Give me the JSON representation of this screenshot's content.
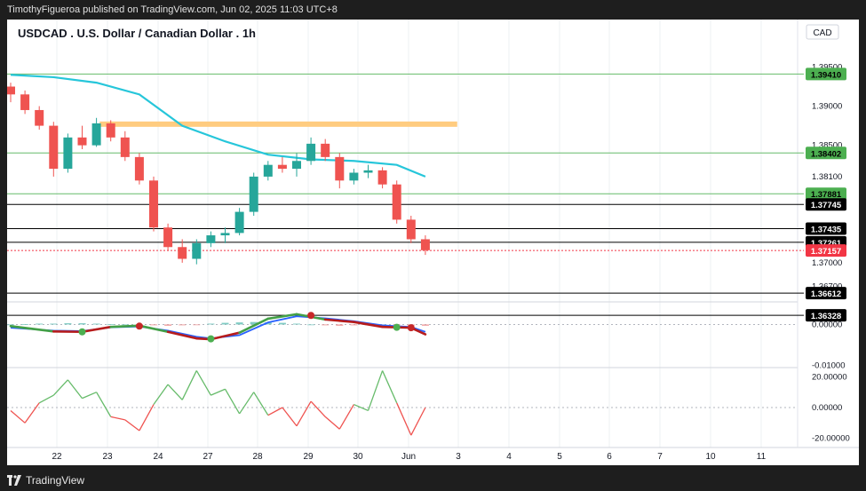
{
  "publish_line": "TimothyFigueroa published on TradingView.com, Jun 02, 2025 11:03 UTC+8",
  "brand": "TradingView",
  "chart_data": {
    "type": "candlestick",
    "title": "USDCAD . U.S. Dollar / Canadian Dollar . 1h",
    "currency": "CAD",
    "x_tick_labels": [
      "22",
      "23",
      "24",
      "27",
      "28",
      "29",
      "30",
      "Jun",
      "3",
      "4",
      "5",
      "6",
      "7",
      "10",
      "11"
    ],
    "price_axis": {
      "ylim": [
        1.365,
        1.3963
      ],
      "tick_labels": [
        "1.39500",
        "1.39000",
        "1.38500",
        "1.38100",
        "1.37000",
        "1.36700"
      ]
    },
    "horizontal_levels": [
      {
        "label": "1.39410",
        "value": 1.3941,
        "color": "#66bb6a",
        "style": "green"
      },
      {
        "label": "1.38402",
        "value": 1.38402,
        "color": "#66bb6a",
        "style": "green"
      },
      {
        "label": "1.37881",
        "value": 1.37881,
        "color": "#66bb6a",
        "style": "green"
      },
      {
        "label": "1.37745",
        "value": 1.37745,
        "color": "#000000",
        "style": "black"
      },
      {
        "label": "1.37435",
        "value": 1.37435,
        "color": "#000000",
        "style": "black"
      },
      {
        "label": "1.37261",
        "value": 1.37261,
        "color": "#000000",
        "style": "black"
      },
      {
        "label": "1.37157",
        "value": 1.37157,
        "color": "#f23645",
        "style": "current"
      },
      {
        "label": "1.36612",
        "value": 1.36612,
        "color": "#000000",
        "style": "black"
      },
      {
        "label": "1.36328",
        "value": 1.36328,
        "color": "#000000",
        "style": "black"
      }
    ],
    "zone": {
      "from_x": 2.5,
      "to_x": 27.5,
      "value": 1.3877,
      "color": "#ffcc80"
    },
    "candles": [
      {
        "x": 0,
        "o": 1.3925,
        "h": 1.393,
        "l": 1.3905,
        "c": 1.3915
      },
      {
        "x": 1,
        "o": 1.3915,
        "h": 1.392,
        "l": 1.389,
        "c": 1.3895
      },
      {
        "x": 2,
        "o": 1.3895,
        "h": 1.39,
        "l": 1.387,
        "c": 1.3875
      },
      {
        "x": 3,
        "o": 1.3875,
        "h": 1.388,
        "l": 1.381,
        "c": 1.382
      },
      {
        "x": 4,
        "o": 1.382,
        "h": 1.3865,
        "l": 1.3815,
        "c": 1.386
      },
      {
        "x": 5,
        "o": 1.386,
        "h": 1.3875,
        "l": 1.3845,
        "c": 1.385
      },
      {
        "x": 6,
        "o": 1.385,
        "h": 1.3885,
        "l": 1.3848,
        "c": 1.3878
      },
      {
        "x": 7,
        "o": 1.3878,
        "h": 1.3882,
        "l": 1.3855,
        "c": 1.386
      },
      {
        "x": 8,
        "o": 1.386,
        "h": 1.3868,
        "l": 1.383,
        "c": 1.3835
      },
      {
        "x": 9,
        "o": 1.3835,
        "h": 1.384,
        "l": 1.38,
        "c": 1.3805
      },
      {
        "x": 10,
        "o": 1.3805,
        "h": 1.381,
        "l": 1.374,
        "c": 1.3745
      },
      {
        "x": 11,
        "o": 1.3745,
        "h": 1.375,
        "l": 1.3715,
        "c": 1.372
      },
      {
        "x": 12,
        "o": 1.372,
        "h": 1.373,
        "l": 1.37,
        "c": 1.3705
      },
      {
        "x": 13,
        "o": 1.3705,
        "h": 1.373,
        "l": 1.3698,
        "c": 1.3725
      },
      {
        "x": 14,
        "o": 1.3725,
        "h": 1.374,
        "l": 1.372,
        "c": 1.3735
      },
      {
        "x": 15,
        "o": 1.3735,
        "h": 1.3745,
        "l": 1.3725,
        "c": 1.3738
      },
      {
        "x": 16,
        "o": 1.3738,
        "h": 1.377,
        "l": 1.3735,
        "c": 1.3765
      },
      {
        "x": 17,
        "o": 1.3765,
        "h": 1.3815,
        "l": 1.376,
        "c": 1.381
      },
      {
        "x": 18,
        "o": 1.381,
        "h": 1.383,
        "l": 1.3805,
        "c": 1.3825
      },
      {
        "x": 19,
        "o": 1.3825,
        "h": 1.3835,
        "l": 1.3815,
        "c": 1.382
      },
      {
        "x": 20,
        "o": 1.382,
        "h": 1.384,
        "l": 1.381,
        "c": 1.383
      },
      {
        "x": 21,
        "o": 1.383,
        "h": 1.386,
        "l": 1.3825,
        "c": 1.3852
      },
      {
        "x": 22,
        "o": 1.3852,
        "h": 1.3858,
        "l": 1.383,
        "c": 1.3835
      },
      {
        "x": 23,
        "o": 1.3835,
        "h": 1.384,
        "l": 1.3795,
        "c": 1.3805
      },
      {
        "x": 24,
        "o": 1.3805,
        "h": 1.382,
        "l": 1.38,
        "c": 1.3815
      },
      {
        "x": 25,
        "o": 1.3815,
        "h": 1.3825,
        "l": 1.3808,
        "c": 1.3818
      },
      {
        "x": 26,
        "o": 1.3818,
        "h": 1.3822,
        "l": 1.3795,
        "c": 1.38
      },
      {
        "x": 27,
        "o": 1.38,
        "h": 1.3805,
        "l": 1.375,
        "c": 1.3755
      },
      {
        "x": 28,
        "o": 1.3755,
        "h": 1.376,
        "l": 1.3725,
        "c": 1.373
      },
      {
        "x": 29,
        "o": 1.373,
        "h": 1.3735,
        "l": 1.371,
        "c": 1.3716
      }
    ],
    "ma_line": {
      "color": "#26c6da",
      "points": [
        {
          "x": 0,
          "y": 1.394
        },
        {
          "x": 3,
          "y": 1.3937
        },
        {
          "x": 6,
          "y": 1.393
        },
        {
          "x": 9,
          "y": 1.3915
        },
        {
          "x": 12,
          "y": 1.3875
        },
        {
          "x": 15,
          "y": 1.3855
        },
        {
          "x": 18,
          "y": 1.3838
        },
        {
          "x": 21,
          "y": 1.3832
        },
        {
          "x": 24,
          "y": 1.383
        },
        {
          "x": 27,
          "y": 1.3825
        },
        {
          "x": 29,
          "y": 1.381
        }
      ]
    },
    "macd": {
      "tick_labels": [
        "0.00000",
        "-0.01000"
      ],
      "ylim": [
        -0.0105,
        0.0055
      ],
      "zero_line": 0.0,
      "macd_line": [
        {
          "x": 0,
          "y": -0.0004
        },
        {
          "x": 3,
          "y": -0.0017
        },
        {
          "x": 5,
          "y": -0.0018
        },
        {
          "x": 7,
          "y": -0.0006
        },
        {
          "x": 9,
          "y": -0.0003
        },
        {
          "x": 11,
          "y": -0.0018
        },
        {
          "x": 13,
          "y": -0.0034
        },
        {
          "x": 14,
          "y": -0.0036
        },
        {
          "x": 16,
          "y": -0.002
        },
        {
          "x": 18,
          "y": 0.0014
        },
        {
          "x": 20,
          "y": 0.0025
        },
        {
          "x": 22,
          "y": 0.0012
        },
        {
          "x": 24,
          "y": 0.0006
        },
        {
          "x": 26,
          "y": -0.0006
        },
        {
          "x": 28,
          "y": -0.0008
        },
        {
          "x": 29,
          "y": -0.0024
        }
      ],
      "signal_line": [
        {
          "x": 0,
          "y": -0.0008
        },
        {
          "x": 3,
          "y": -0.0015
        },
        {
          "x": 5,
          "y": -0.0016
        },
        {
          "x": 7,
          "y": -0.0007
        },
        {
          "x": 9,
          "y": -0.0005
        },
        {
          "x": 11,
          "y": -0.0015
        },
        {
          "x": 13,
          "y": -0.003
        },
        {
          "x": 14,
          "y": -0.0034
        },
        {
          "x": 16,
          "y": -0.0026
        },
        {
          "x": 18,
          "y": 0.0005
        },
        {
          "x": 20,
          "y": 0.002
        },
        {
          "x": 22,
          "y": 0.0015
        },
        {
          "x": 24,
          "y": 0.0008
        },
        {
          "x": 26,
          "y": -0.0002
        },
        {
          "x": 28,
          "y": -0.0006
        },
        {
          "x": 29,
          "y": -0.0018
        }
      ],
      "cross_markers": [
        {
          "x": 5,
          "y": -0.0018,
          "kind": "bullish"
        },
        {
          "x": 9,
          "y": -0.0004,
          "kind": "bearish"
        },
        {
          "x": 14,
          "y": -0.0035,
          "kind": "bullish"
        },
        {
          "x": 21,
          "y": 0.0022,
          "kind": "bearish"
        },
        {
          "x": 27,
          "y": -0.0007,
          "kind": "bullish"
        },
        {
          "x": 28,
          "y": -0.0008,
          "kind": "bearish"
        }
      ],
      "hist_values": [
        0.0,
        0.0001,
        0.0002,
        0.0002,
        0.0003,
        0.0003,
        0.0002,
        0.0001,
        0.0,
        -0.0001,
        -0.0002,
        -0.0003,
        -0.0002,
        -0.0001,
        0.0002,
        0.0004,
        0.0005,
        0.0006,
        0.0005,
        0.0004,
        0.0002,
        0.0,
        -0.0002,
        -0.0003,
        -0.0002,
        -0.0001,
        0.0,
        -0.0001,
        -0.0003,
        -0.0003
      ]
    },
    "oscillator": {
      "tick_labels": [
        "20.00000",
        "0.00000",
        "-20.00000"
      ],
      "ylim": [
        -26,
        26
      ],
      "zero_line": 0,
      "values": [
        {
          "x": 0,
          "y": -2
        },
        {
          "x": 1,
          "y": -10
        },
        {
          "x": 2,
          "y": 3
        },
        {
          "x": 3,
          "y": 8
        },
        {
          "x": 4,
          "y": 18
        },
        {
          "x": 5,
          "y": 6
        },
        {
          "x": 6,
          "y": 10
        },
        {
          "x": 7,
          "y": -6
        },
        {
          "x": 8,
          "y": -8
        },
        {
          "x": 9,
          "y": -15
        },
        {
          "x": 10,
          "y": 2
        },
        {
          "x": 11,
          "y": 15
        },
        {
          "x": 12,
          "y": 5
        },
        {
          "x": 13,
          "y": 24
        },
        {
          "x": 14,
          "y": 8
        },
        {
          "x": 15,
          "y": 12
        },
        {
          "x": 16,
          "y": -4
        },
        {
          "x": 17,
          "y": 10
        },
        {
          "x": 18,
          "y": -5
        },
        {
          "x": 19,
          "y": 0
        },
        {
          "x": 20,
          "y": -12
        },
        {
          "x": 21,
          "y": 4
        },
        {
          "x": 22,
          "y": -6
        },
        {
          "x": 23,
          "y": -14
        },
        {
          "x": 24,
          "y": 2
        },
        {
          "x": 25,
          "y": -2
        },
        {
          "x": 26,
          "y": 24
        },
        {
          "x": 27,
          "y": 3
        },
        {
          "x": 28,
          "y": -18
        },
        {
          "x": 29,
          "y": 0
        }
      ]
    }
  }
}
